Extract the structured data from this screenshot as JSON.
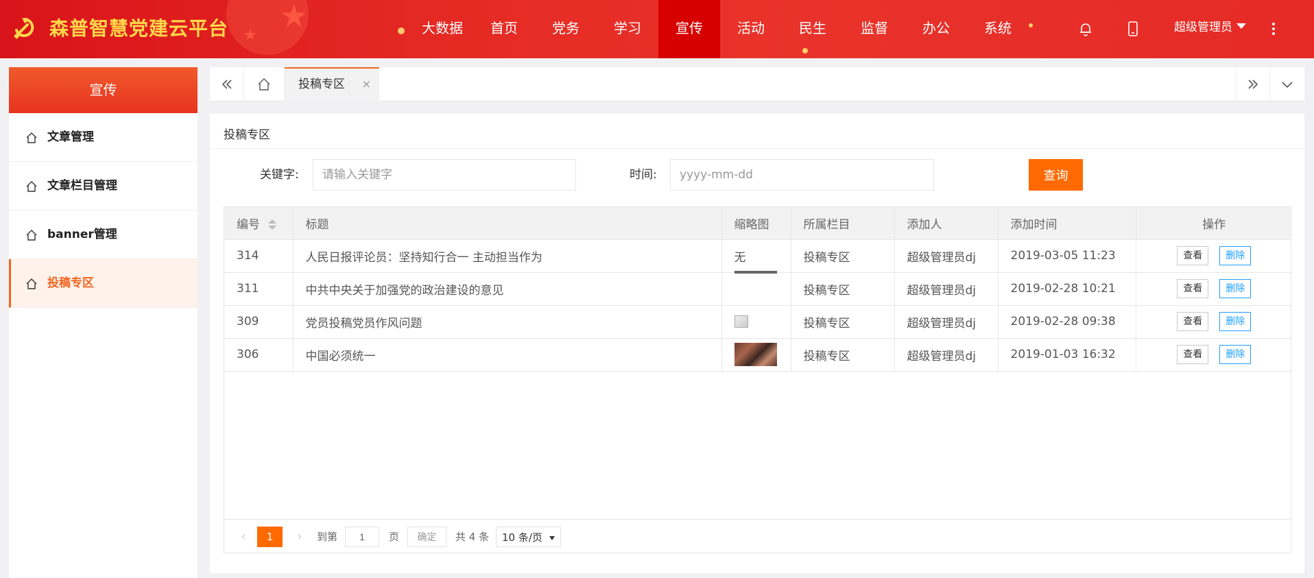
{
  "header": {
    "brand": "森普智慧党建云平台",
    "nav": [
      "大数据",
      "首页",
      "党务",
      "学习",
      "宣传",
      "活动",
      "民生",
      "监督",
      "办公",
      "系统"
    ],
    "active_nav": "宣传",
    "user": "超级管理员"
  },
  "sidebar": {
    "title": "宣传",
    "items": [
      {
        "label": "文章管理"
      },
      {
        "label": "文章栏目管理"
      },
      {
        "label": "banner管理"
      },
      {
        "label": "投稿专区"
      }
    ],
    "active": "投稿专区"
  },
  "tabs": {
    "active_label": "投稿专区",
    "close_glyph": "×"
  },
  "panel": {
    "title": "投稿专区",
    "keyword_label": "关键字:",
    "keyword_placeholder": "请输入关键字",
    "time_label": "时间:",
    "time_placeholder": "yyyy-mm-dd",
    "query_button": "查询"
  },
  "table": {
    "headers": [
      "编号",
      "标题",
      "缩略图",
      "所属栏目",
      "添加人",
      "添加时间",
      "操作"
    ],
    "rows": [
      {
        "id": "314",
        "title": "人民日报评论员：坚持知行合一 主动担当作为",
        "thumb_text": "无",
        "column": "投稿专区",
        "author": "超级管理员dj",
        "time": "2019-03-05 11:23"
      },
      {
        "id": "311",
        "title": "中共中央关于加强党的政治建设的意见",
        "thumb_text": "",
        "column": "投稿专区",
        "author": "超级管理员dj",
        "time": "2019-02-28 10:21"
      },
      {
        "id": "309",
        "title": "党员投稿党员作风问题",
        "thumb_text": "",
        "column": "投稿专区",
        "author": "超级管理员dj",
        "time": "2019-02-28 09:38"
      },
      {
        "id": "306",
        "title": "中国必须统一",
        "thumb_text": "",
        "column": "投稿专区",
        "author": "超级管理员dj",
        "time": "2019-01-03 16:32"
      }
    ],
    "view_label": "查看",
    "delete_label": "删除"
  },
  "pager": {
    "current": "1",
    "goto_label": "到第",
    "goto_value": "1",
    "page_label": "页",
    "confirm_label": "确定",
    "total": "共 4 条",
    "page_size": "10 条/页"
  },
  "colors": {
    "header_red": "#e52a24",
    "accent_orange": "#ff6a00",
    "brand_gold": "#ffd84a",
    "link_blue": "#1e9fff"
  }
}
